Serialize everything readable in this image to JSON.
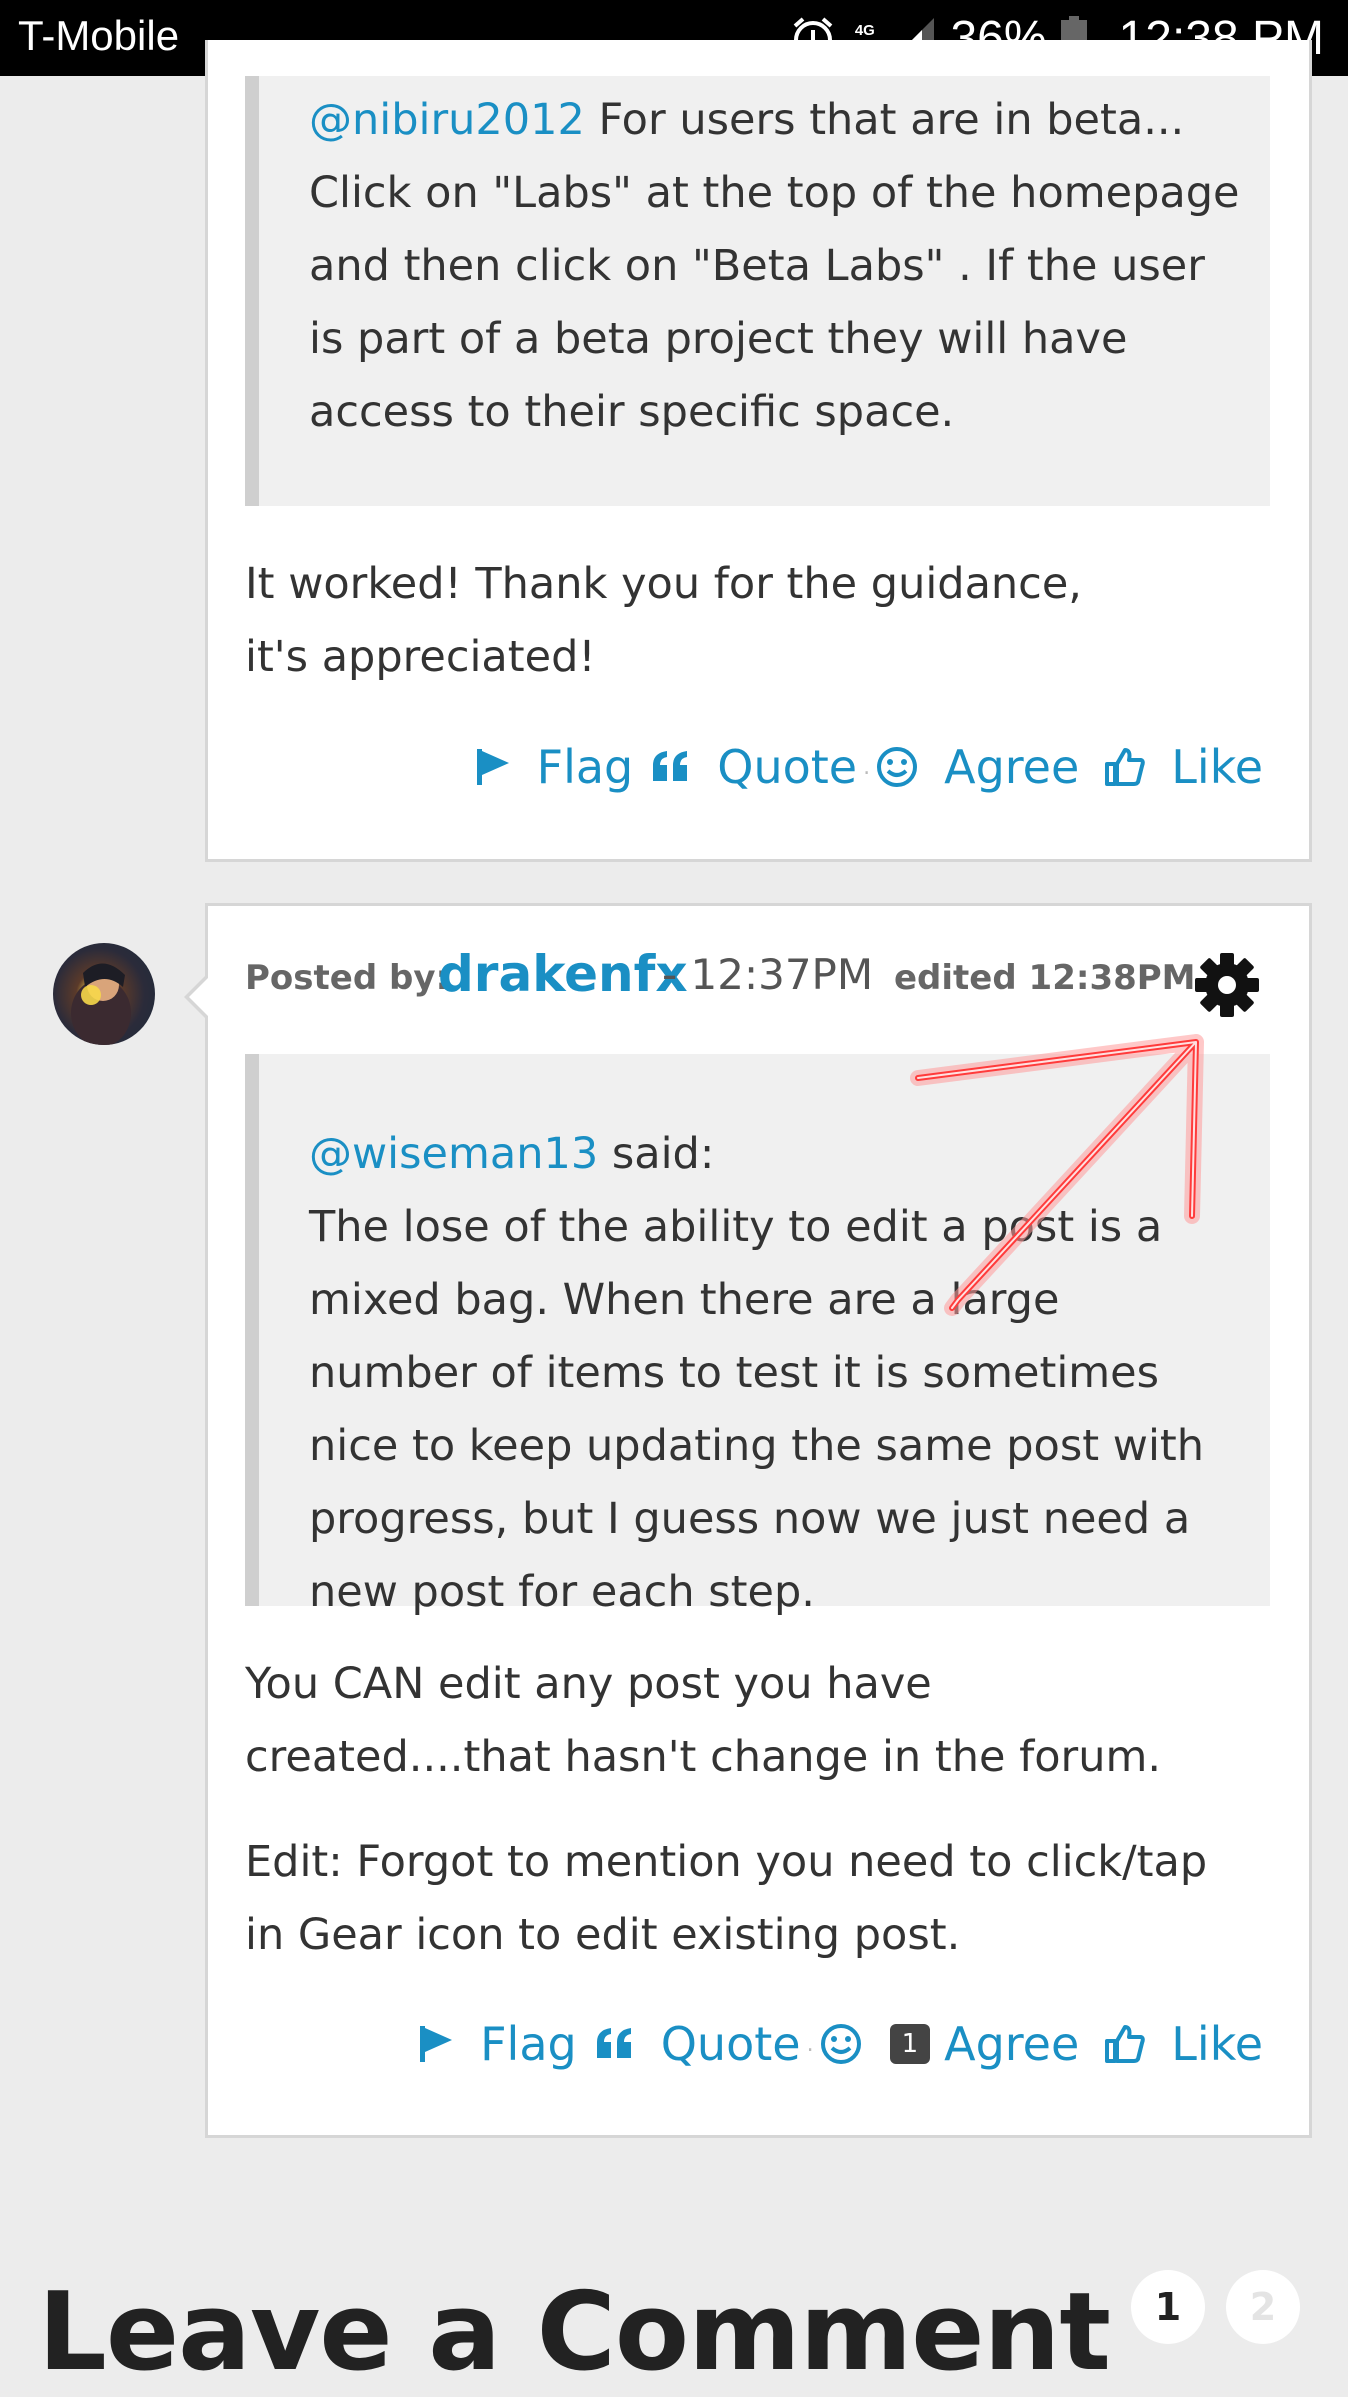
{
  "status_bar": {
    "carrier": "T-Mobile",
    "network": "4G LTE",
    "battery": "36%",
    "time": "12:38 PM",
    "icons": [
      "alarm-icon",
      "network-icon",
      "signal-icon",
      "battery-icon"
    ]
  },
  "post1": {
    "quote": {
      "mention": "@nibiru2012",
      "text": " For users that are in beta... Click on \"Labs\" at the top of the homepage and then click on \"Beta Labs\" . If the user is part of a beta project they will have access to their specific space."
    },
    "body": "It worked! Thank you for the guidance, it's appreciated!",
    "actions": {
      "flag": "Flag",
      "quote": "Quote",
      "agree": "Agree",
      "like": "Like"
    }
  },
  "post2": {
    "posted_by_label": "Posted by:",
    "author": "drakenfx",
    "time": "- 12:37PM",
    "edited": "edited 12:38PM",
    "quote": {
      "mention": "@wiseman13",
      "said": " said:",
      "text": "The lose of the ability to edit a post is a mixed bag. When there are a large number of items to test it is sometimes nice to keep updating the same post with progress, but I guess now we just need a new post for each step."
    },
    "body1": "You CAN edit any post you have created....that hasn't change in the forum.",
    "body2": "Edit: Forgot to mention you need to click/tap in Gear icon to edit existing post.",
    "actions": {
      "flag": "Flag",
      "quote": "Quote",
      "agree_count": "1",
      "agree": "Agree",
      "like": "Like"
    }
  },
  "leave_comment": {
    "title": "Leave a Comment"
  },
  "pagination": {
    "pages": [
      "1",
      "2"
    ],
    "current": "1"
  },
  "colors": {
    "link": "#1a8fc4",
    "annotation": "#ff4a4a"
  }
}
